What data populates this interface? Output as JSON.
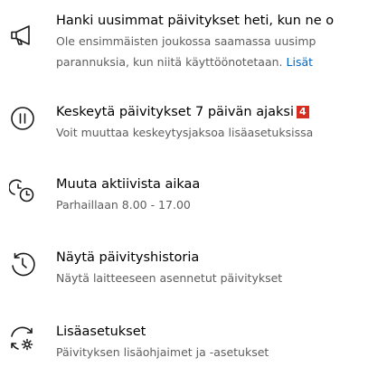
{
  "items": [
    {
      "icon": "megaphone-icon",
      "title": "Hanki uusimmat päivitykset heti, kun ne o",
      "desc_line1": "Ole ensimmäisten joukossa saamassa uusimp",
      "desc_line2": "parannuksia, kun niitä käyttöönotetaan.",
      "link": "Lisät"
    },
    {
      "icon": "pause-icon",
      "title": "Keskeytä päivitykset 7 päivän ajaksi",
      "badge": "4",
      "desc": "Voit muuttaa keskeytysjaksoa lisäasetuksissa"
    },
    {
      "icon": "active-hours-clock-icon",
      "title": "Muuta aktiivista aikaa",
      "desc": "Parhaillaan 8.00 - 17.00"
    },
    {
      "icon": "history-icon",
      "title": "Näytä päivityshistoria",
      "desc": "Näytä laitteeseen asennetut päivitykset"
    },
    {
      "icon": "sync-gear-icon",
      "title": "Lisäasetukset",
      "desc": "Päivityksen lisäohjaimet ja -asetukset"
    }
  ],
  "colors": {
    "badge": "#d62d20",
    "link": "#0067c0",
    "secondary_text": "#5d5d5d"
  }
}
